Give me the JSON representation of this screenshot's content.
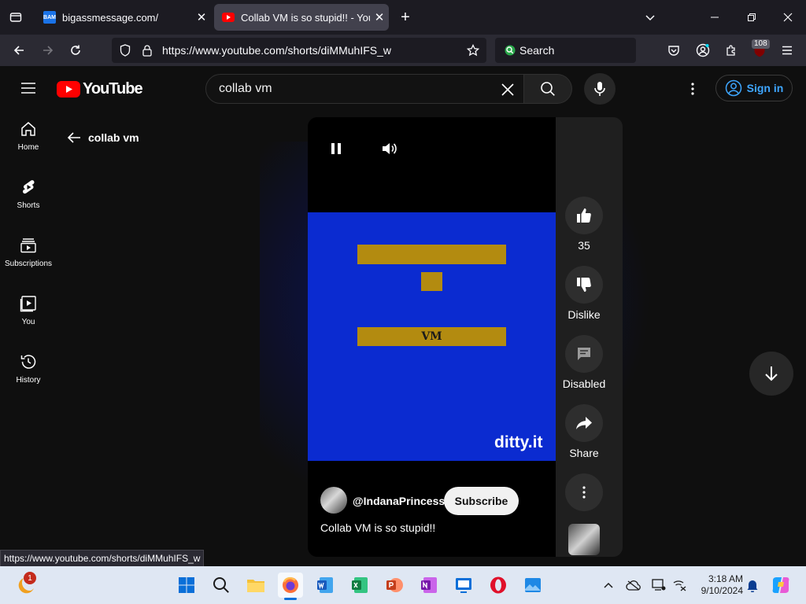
{
  "browser": {
    "tabs": [
      {
        "title": "bigassmessage.com/",
        "favicon_text": "BAM",
        "active": false
      },
      {
        "title": "Collab VM is so stupid!! - YouTube",
        "active": true
      }
    ],
    "url": "https://www.youtube.com/shorts/diMMuhIFS_w",
    "search_placeholder": "Search",
    "extension_badge": "108",
    "status_url": "https://www.youtube.com/shorts/diMMuhIFS_w"
  },
  "youtube": {
    "logo_text": "YouTube",
    "search_value": "collab vm",
    "sign_in_label": "Sign in",
    "back_label": "collab vm",
    "sidebar": [
      {
        "label": "Home",
        "icon": "home-icon"
      },
      {
        "label": "Shorts",
        "icon": "shorts-icon"
      },
      {
        "label": "Subscriptions",
        "icon": "subscriptions-icon"
      },
      {
        "label": "You",
        "icon": "you-icon"
      },
      {
        "label": "History",
        "icon": "history-icon"
      }
    ],
    "short": {
      "video_text": "VM",
      "watermark": "ditty.it",
      "channel": "@IndanaPrincess",
      "subscribe_label": "Subscribe",
      "title": "Collab VM is so stupid!!"
    },
    "actions": {
      "likes": "35",
      "dislike_label": "Dislike",
      "comments_label": "Disabled",
      "share_label": "Share"
    }
  },
  "taskbar": {
    "time": "3:18 AM",
    "date": "9/10/2024",
    "notification_badge": "1"
  },
  "colors": {
    "youtube_red": "#ff0000",
    "video_blue": "#0b2bd0",
    "bar_gold": "#b38b10",
    "link_blue": "#3ea6ff"
  }
}
